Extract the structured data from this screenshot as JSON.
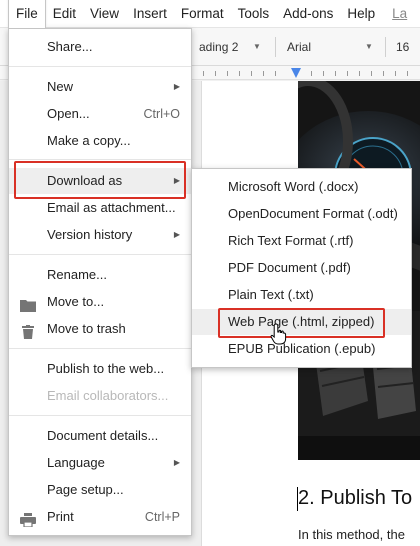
{
  "menubar": {
    "items": [
      "File",
      "Edit",
      "View",
      "Insert",
      "Format",
      "Tools",
      "Add-ons",
      "Help"
    ],
    "last_edit": "La"
  },
  "toolbar": {
    "style_select": "ading 2",
    "font_select": "Arial",
    "size_select": "16"
  },
  "file_menu": {
    "share": "Share...",
    "new": "New",
    "open": "Open...",
    "open_shortcut": "Ctrl+O",
    "make_copy": "Make a copy...",
    "download_as": "Download as",
    "email_attachment": "Email as attachment...",
    "version_history": "Version history",
    "rename": "Rename...",
    "move_to": "Move to...",
    "move_to_trash": "Move to trash",
    "publish_web": "Publish to the web...",
    "email_collaborators": "Email collaborators...",
    "document_details": "Document details...",
    "language": "Language",
    "page_setup": "Page setup...",
    "print": "Print",
    "print_shortcut": "Ctrl+P"
  },
  "download_submenu": {
    "items": [
      "Microsoft Word (.docx)",
      "OpenDocument Format (.odt)",
      "Rich Text Format (.rtf)",
      "PDF Document (.pdf)",
      "Plain Text (.txt)",
      "Web Page (.html, zipped)",
      "EPUB Publication (.epub)"
    ]
  },
  "document": {
    "heading": "2. Publish To",
    "body": "In this method, the"
  },
  "colors": {
    "highlight_box": "#d93025",
    "ruler_marker": "#4a86e8"
  }
}
